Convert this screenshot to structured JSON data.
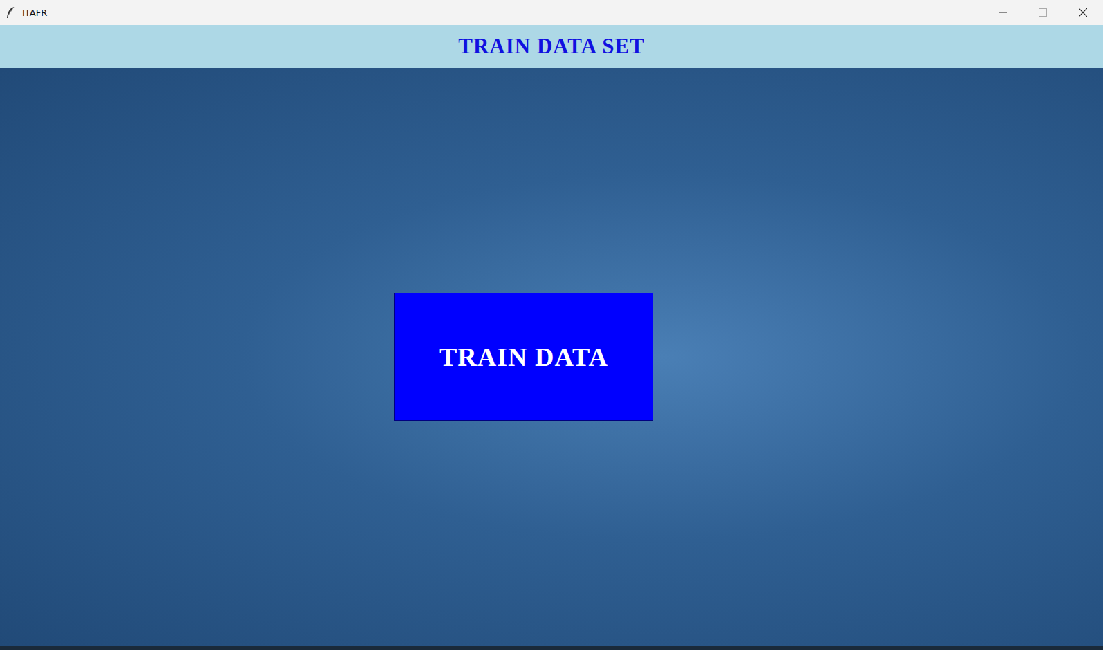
{
  "window": {
    "title": "ITAFR"
  },
  "header": {
    "title": "TRAIN DATA SET"
  },
  "train_button": {
    "label": "TRAIN DATA"
  }
}
